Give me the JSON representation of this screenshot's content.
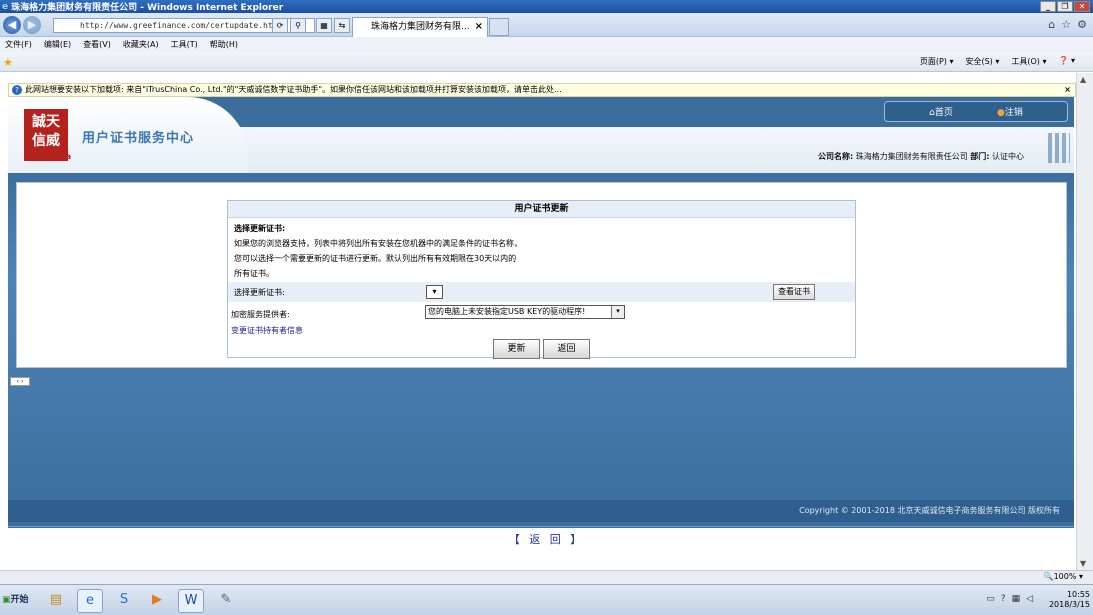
{
  "window": {
    "title": "珠海格力集团财务有限责任公司 - Windows Internet Explorer",
    "buttons": [
      "_",
      "❐",
      "✕"
    ]
  },
  "browser": {
    "url": "http://www.greefinance.com/certupdate.html",
    "tab_title": "珠海格力集团财务有限...",
    "tab_close": "×"
  },
  "menu": {
    "items": [
      "文件(F)",
      "编辑(E)",
      "查看(V)",
      "收藏夹(A)",
      "工具(T)",
      "帮助(H)"
    ]
  },
  "command_bar": {
    "items": [
      "页面(P) ▾",
      "安全(S) ▾",
      "工具(O) ▾",
      "❓ ▾"
    ]
  },
  "infobar": {
    "text": "此网站想要安装以下加载项: 来自\"iTrusChina Co., Ltd.\"的\"天威诚信数字证书助手\"。如果你信任该网站和该加载项并打算安装该加载项，请单击此处...",
    "close": "×"
  },
  "site": {
    "logo_chars": "誠天\n信威",
    "logo_brand": "iTrusChina",
    "title": "用户证书服务中心",
    "nav_home": "首页",
    "nav_logout": "注销",
    "company_label": "公司名称:",
    "company_name": "珠海格力集团财务有限责任公司",
    "dept_label": "部门:",
    "dept_name": "认证中心"
  },
  "form": {
    "title": "用户证书更新",
    "desc_heading": "选择更新证书:",
    "desc_lines": [
      "如果您的浏览器支持，列表中将列出所有安装在您机器中的满足条件的证书名称，",
      "您可以选择一个需要更新的证书进行更新。默认列出所有有效期限在30天以内的",
      "所有证书。"
    ],
    "select_label": "选择更新证书:",
    "view_button": "查看证书",
    "csp_label": "加密服务提供者:",
    "csp_value": "您的电脑上未安装指定USB KEY的驱动程序!",
    "change_link": "变更证书持有者信息",
    "update_button": "更新",
    "back_button": "返回"
  },
  "footer": {
    "copyright": "Copyright © 2001-2018 北京天威诚信电子商务服务有限公司 版权所有",
    "back_link": "【 返 回 】"
  },
  "statusbar": {
    "zoom": "🔍100% ▾"
  },
  "taskbar": {
    "start": "开始",
    "time": "10:55",
    "date": "2018/3/15"
  }
}
